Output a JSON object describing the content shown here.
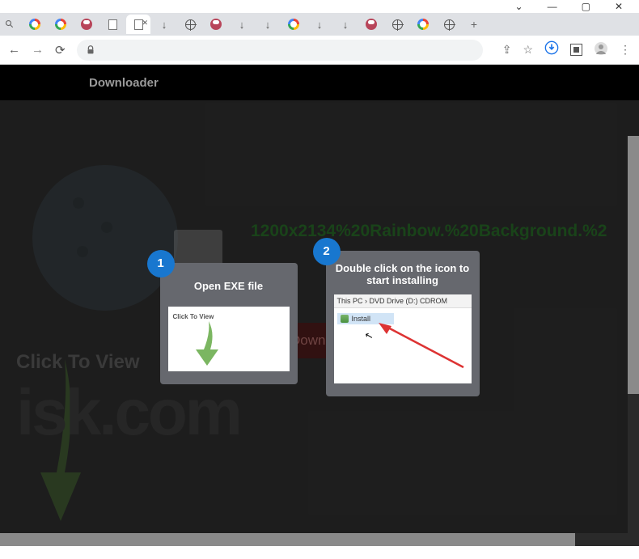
{
  "window": {
    "dropdown": "⌄",
    "min": "—",
    "max": "▢",
    "close": "✕"
  },
  "tabs": {
    "count": 17,
    "active_index": 4,
    "new": "+"
  },
  "nav": {
    "back": "←",
    "fwd": "→",
    "reload": "⟳"
  },
  "toolbar": {
    "share": "⇪",
    "star": "☆",
    "ext": "▣",
    "profile": "◉",
    "menu": "⋮"
  },
  "page": {
    "brand": "Downloader",
    "filename": "1200x2134%20Rainbow.%20Background.%2",
    "download_btn": "Download",
    "watermark1": "Click To View",
    "watermark2": "isk.com"
  },
  "modal": {
    "step1": {
      "num": "1",
      "title": "Open EXE file",
      "thumb_text": "Click To View"
    },
    "step2": {
      "num": "2",
      "title": "Double click on the icon to start installing",
      "crumb_a": "This PC",
      "crumb_b": "DVD Drive (D:) CDROM",
      "crumb_sep": "›",
      "install": "Install"
    }
  }
}
